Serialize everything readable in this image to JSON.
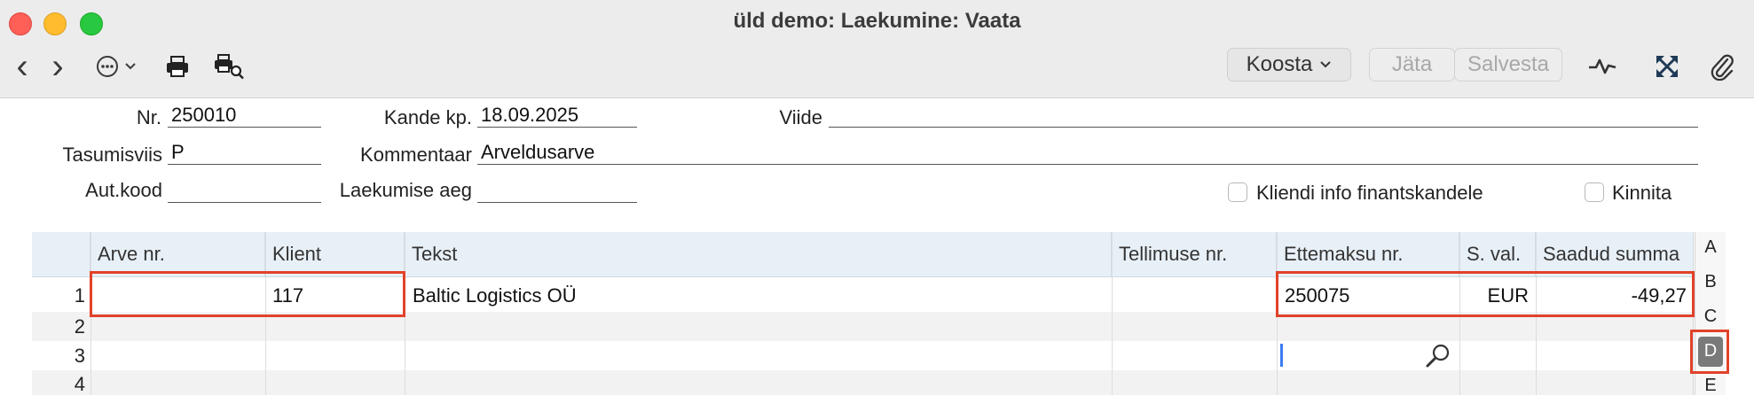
{
  "window": {
    "title": "üld demo: Laekumine: Vaata"
  },
  "toolbar": {
    "koosta_label": "Koosta",
    "jata_label": "Jäta",
    "salvesta_label": "Salvesta",
    "back_glyph": "‹",
    "forward_glyph": "›",
    "more_glyph": "⋯",
    "chevron_glyph": "⌄"
  },
  "form": {
    "nr_label": "Nr.",
    "nr_value": "250010",
    "kande_label": "Kande kp.",
    "kande_value": "18.09.2025",
    "viide_label": "Viide",
    "viide_value": "",
    "tasumisviis_label": "Tasumisviis",
    "tasumisviis_value": "P",
    "kommentaar_label": "Kommentaar",
    "kommentaar_value": "Arveldusarve",
    "autkood_label": "Aut.kood",
    "autkood_value": "",
    "laekumise_label": "Laekumise aeg",
    "laekumise_value": "",
    "kliendi_label": "Kliendi info finantskandele",
    "kinnita_label": "Kinnita"
  },
  "grid": {
    "headers": [
      "Arve nr.",
      "Klient",
      "Tekst",
      "Tellimuse nr.",
      "Ettemaksu nr.",
      "S. val.",
      "Saadud summa"
    ],
    "rows": [
      {
        "num": "1",
        "arve": "",
        "klient": "117",
        "tekst": "Baltic Logistics OÜ",
        "tellimus": "",
        "ettemaks": "250075",
        "val": "EUR",
        "summa": "-49,27"
      },
      {
        "num": "2"
      },
      {
        "num": "3"
      },
      {
        "num": "4"
      }
    ]
  },
  "side_tabs": [
    "A",
    "B",
    "C",
    "D",
    "E"
  ]
}
